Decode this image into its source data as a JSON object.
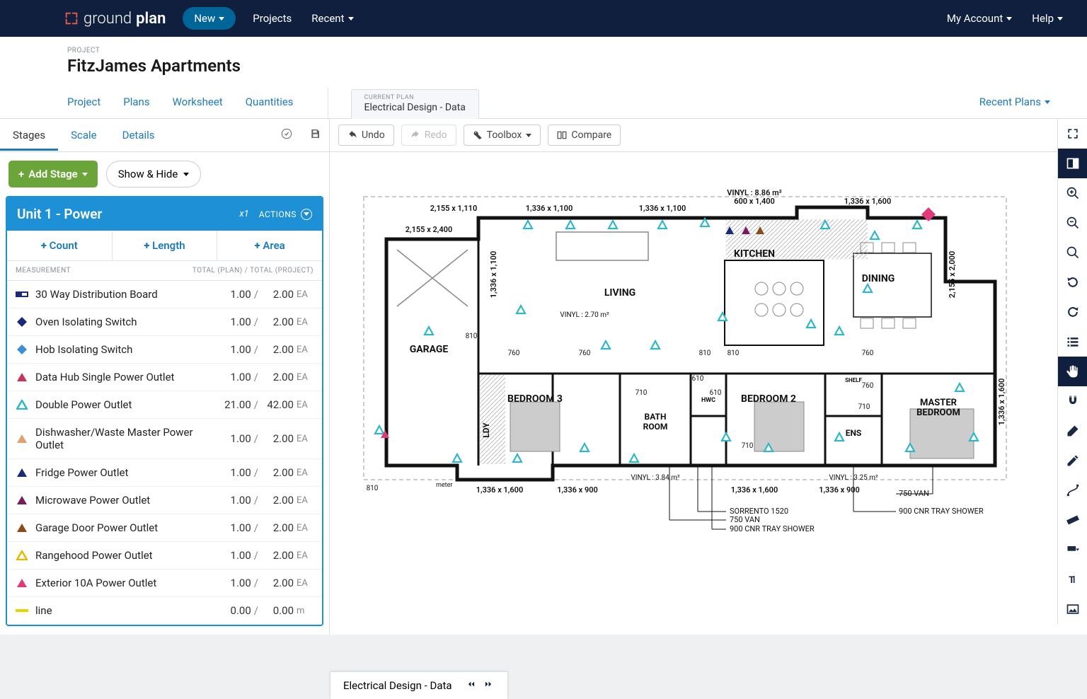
{
  "nav": {
    "logo_a": "ground",
    "logo_b": "plan",
    "new": "New",
    "projects": "Projects",
    "recent": "Recent",
    "my_account": "My Account",
    "help": "Help"
  },
  "project": {
    "label": "PROJECT",
    "title": "FitzJames Apartments",
    "tabs": [
      "Project",
      "Plans",
      "Worksheet",
      "Quantities"
    ],
    "current_plan_label": "CURRENT PLAN",
    "current_plan_name": "Electrical Design - Data",
    "recent_plans": "Recent Plans"
  },
  "side": {
    "tabs": [
      "Stages",
      "Scale",
      "Details"
    ],
    "add_stage": "Add Stage",
    "show_hide": "Show & Hide"
  },
  "stage": {
    "title": "Unit 1 - Power",
    "multiplier": "x1",
    "actions": "ACTIONS",
    "add": [
      "Count",
      "Length",
      "Area"
    ],
    "header_left": "MEASUREMENT",
    "header_right": "TOTAL (PLAN) / TOTAL (PROJECT)"
  },
  "measurements": [
    {
      "name": "30 Way Distribution Board",
      "v1": "1.00",
      "v2": "2.00",
      "unit": "EA",
      "shape": "rect",
      "color": "#1a2a7a"
    },
    {
      "name": "Oven Isolating Switch",
      "v1": "1.00",
      "v2": "2.00",
      "unit": "EA",
      "shape": "diamond",
      "color": "#1a2a7a"
    },
    {
      "name": "Hob Isolating Switch",
      "v1": "1.00",
      "v2": "2.00",
      "unit": "EA",
      "shape": "diamond",
      "color": "#3a8fd6"
    },
    {
      "name": "Data Hub Single Power Outlet",
      "v1": "1.00",
      "v2": "2.00",
      "unit": "EA",
      "shape": "tri",
      "color": "#c9335a"
    },
    {
      "name": "Double Power Outlet",
      "v1": "21.00",
      "v2": "42.00",
      "unit": "EA",
      "shape": "tri-o",
      "color": "#2fb6c9"
    },
    {
      "name": "Dishwasher/Waste Master Power Outlet",
      "v1": "1.00",
      "v2": "2.00",
      "unit": "EA",
      "shape": "tri",
      "color": "#e0a070"
    },
    {
      "name": "Fridge Power Outlet",
      "v1": "1.00",
      "v2": "2.00",
      "unit": "EA",
      "shape": "tri",
      "color": "#1a2a7a"
    },
    {
      "name": "Microwave Power Outlet",
      "v1": "1.00",
      "v2": "2.00",
      "unit": "EA",
      "shape": "tri",
      "color": "#7a1a5a"
    },
    {
      "name": "Garage Door Power Outlet",
      "v1": "1.00",
      "v2": "2.00",
      "unit": "EA",
      "shape": "tri",
      "color": "#8a4a1a"
    },
    {
      "name": "Rangehood Power Outlet",
      "v1": "1.00",
      "v2": "2.00",
      "unit": "EA",
      "shape": "tri-o",
      "color": "#e6b800"
    },
    {
      "name": "Exterior 10A Power Outlet",
      "v1": "1.00",
      "v2": "2.00",
      "unit": "EA",
      "shape": "tri",
      "color": "#e03a7a"
    },
    {
      "name": "line",
      "v1": "0.00",
      "v2": "0.00",
      "unit": "m",
      "shape": "line",
      "color": "#e6d600"
    }
  ],
  "canvas_tools": {
    "undo": "Undo",
    "redo": "Redo",
    "toolbox": "Toolbox",
    "compare": "Compare"
  },
  "floor": {
    "rooms": {
      "garage": "GARAGE",
      "ldy": "LDY",
      "bed3": "BEDROOM 3",
      "bath": "BATH ROOM",
      "hwc": "HWC",
      "bed2": "BEDROOM 2",
      "ens": "ENS",
      "master": "MASTER BEDROOM",
      "living": "LIVING",
      "kitchen": "KITCHEN",
      "dining": "DINING",
      "shelf": "SHELF"
    },
    "dims": {
      "d1": "2,155 x 1,110",
      "d2": "1,336 x 1,100",
      "d3": "1,336 x 1,100",
      "d4": "600 x 1,400",
      "d5": "1,336 x 1,600",
      "d6": "2,155 x 2,400",
      "d7": "1,336 x 1,100",
      "d8": "2,155 x 2,000",
      "d9": "1,336 x 1,600",
      "d10": "1,336 x 1,600",
      "d11": "1,336 x 900",
      "d12": "1,336 x 1,600",
      "d13": "1,336 x 900",
      "doors": [
        "810",
        "760",
        "760",
        "810",
        "810",
        "760",
        "610",
        "610",
        "710",
        "710",
        "710",
        "760",
        "810"
      ],
      "v1": "VINYL : 8.86 m²",
      "v2": "VINYL : 2.70 m²",
      "v3": "VINYL : 3.84 m²",
      "v4": "VINYL : 3.25 m²",
      "n1": "750 VAN",
      "n2": "SORRENTO 1520",
      "n3": "750 VAN",
      "n4": "900 CNR TRAY SHOWER",
      "n5": "900 CNR TRAY SHOWER",
      "meter": "meter",
      "n810": "810"
    }
  },
  "bottom": {
    "name": "Electrical Design - Data"
  }
}
